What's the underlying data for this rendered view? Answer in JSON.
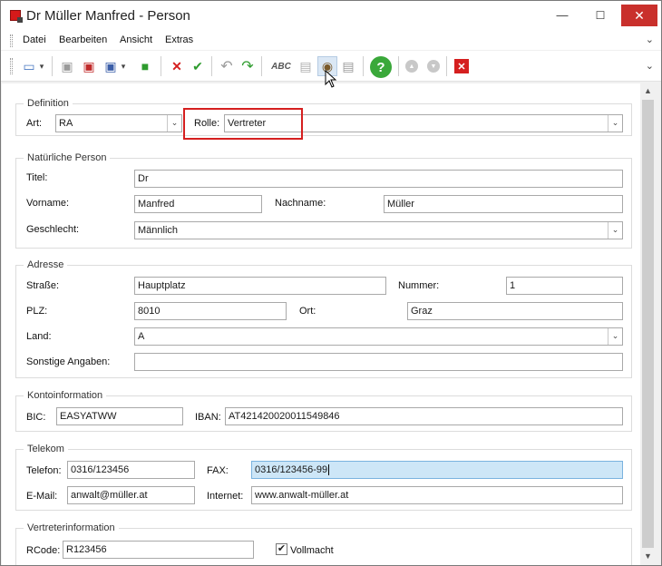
{
  "window": {
    "title": "Dr Müller Manfred - Person",
    "icon": "person-app-icon",
    "controls": {
      "minimize": "—",
      "maximize": "☐",
      "close": "✕"
    }
  },
  "menu": {
    "items": [
      "Datei",
      "Bearbeiten",
      "Ansicht",
      "Extras"
    ],
    "overflow": "⌄"
  },
  "toolbar": {
    "overflow": "⌄",
    "icons": {
      "new": "▭",
      "new_dropdown": "▾",
      "save": "▣",
      "save_close": "▣",
      "save_copy": "▣",
      "copy_dropdown": "▾",
      "green_block": "■",
      "delete": "✕",
      "confirm": "✔",
      "undo": "↶",
      "redo": "↷",
      "spellcheck": "ABC",
      "folder": "▤",
      "camera": "◉",
      "print": "▤",
      "help": "?",
      "nav_up": "▲",
      "nav_down": "▼",
      "close_red": "✕"
    },
    "colors": {
      "red": "#d51f1f",
      "green": "#2e9b2e",
      "gray": "#9a9a9a"
    }
  },
  "sections": {
    "definition": {
      "title": "Definition",
      "art_label": "Art:",
      "art_value": "RA",
      "rolle_label": "Rolle:",
      "rolle_value": "Vertreter"
    },
    "person": {
      "title": "Natürliche Person",
      "titel_label": "Titel:",
      "titel_value": "Dr",
      "vorname_label": "Vorname:",
      "vorname_value": "Manfred",
      "nachname_label": "Nachname:",
      "nachname_value": "Müller",
      "geschlecht_label": "Geschlecht:",
      "geschlecht_value": "Männlich"
    },
    "adresse": {
      "title": "Adresse",
      "strasse_label": "Straße:",
      "strasse_value": "Hauptplatz",
      "nummer_label": "Nummer:",
      "nummer_value": "1",
      "plz_label": "PLZ:",
      "plz_value": "8010",
      "ort_label": "Ort:",
      "ort_value": "Graz",
      "land_label": "Land:",
      "land_value": "A",
      "sonstige_label": "Sonstige Angaben:",
      "sonstige_value": ""
    },
    "konto": {
      "title": "Kontoinformation",
      "bic_label": "BIC:",
      "bic_value": "EASYATWW",
      "iban_label": "IBAN:",
      "iban_value": "AT421420020011549846"
    },
    "telekom": {
      "title": "Telekom",
      "telefon_label": "Telefon:",
      "telefon_value": "0316/123456",
      "fax_label": "FAX:",
      "fax_value": "0316/123456-99",
      "email_label": "E-Mail:",
      "email_value": "anwalt@müller.at",
      "internet_label": "Internet:",
      "internet_value": "www.anwalt-müller.at"
    },
    "vertreter": {
      "title": "Vertreterinformation",
      "rcode_label": "RCode:",
      "rcode_value": "R123456",
      "vollmacht_label": "Vollmacht",
      "vollmacht_checked": true,
      "check_glyph": "✔"
    }
  },
  "dropdown_arrow": "⌄",
  "scrollbar": {
    "up": "▲",
    "down": "▼"
  },
  "highlight_color": "#d51f1f"
}
